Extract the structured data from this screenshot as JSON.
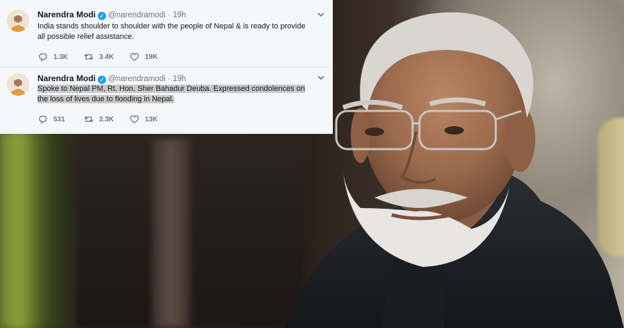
{
  "tweets": [
    {
      "name": "Narendra Modi",
      "handle": "@narendramodi",
      "separator": "·",
      "time": "19h",
      "text": "India stands shoulder to shoulder with the people of Nepal & is ready to provide all possible relief assistance.",
      "replies": "1.3K",
      "retweets": "3.4K",
      "likes": "19K"
    },
    {
      "name": "Narendra Modi",
      "handle": "@narendramodi",
      "separator": "·",
      "time": "19h",
      "text": "Spoke to Nepal PM, Rt. Hon. Sher Bahadur Deuba. Expressed condolences on the loss of lives due to flooding in Nepal.",
      "replies": "531",
      "retweets": "2.3K",
      "likes": "13K"
    }
  ],
  "colors": {
    "card_background": "#f5f8fa",
    "primary_text": "#14171a",
    "secondary_text": "#657786",
    "verified_badge": "#1da1f2",
    "selection_highlight": "#c9c9c9"
  },
  "icons": {
    "verified": "verified-badge-icon",
    "caret": "chevron-down-icon",
    "reply": "reply-icon",
    "retweet": "retweet-icon",
    "like": "heart-icon"
  }
}
